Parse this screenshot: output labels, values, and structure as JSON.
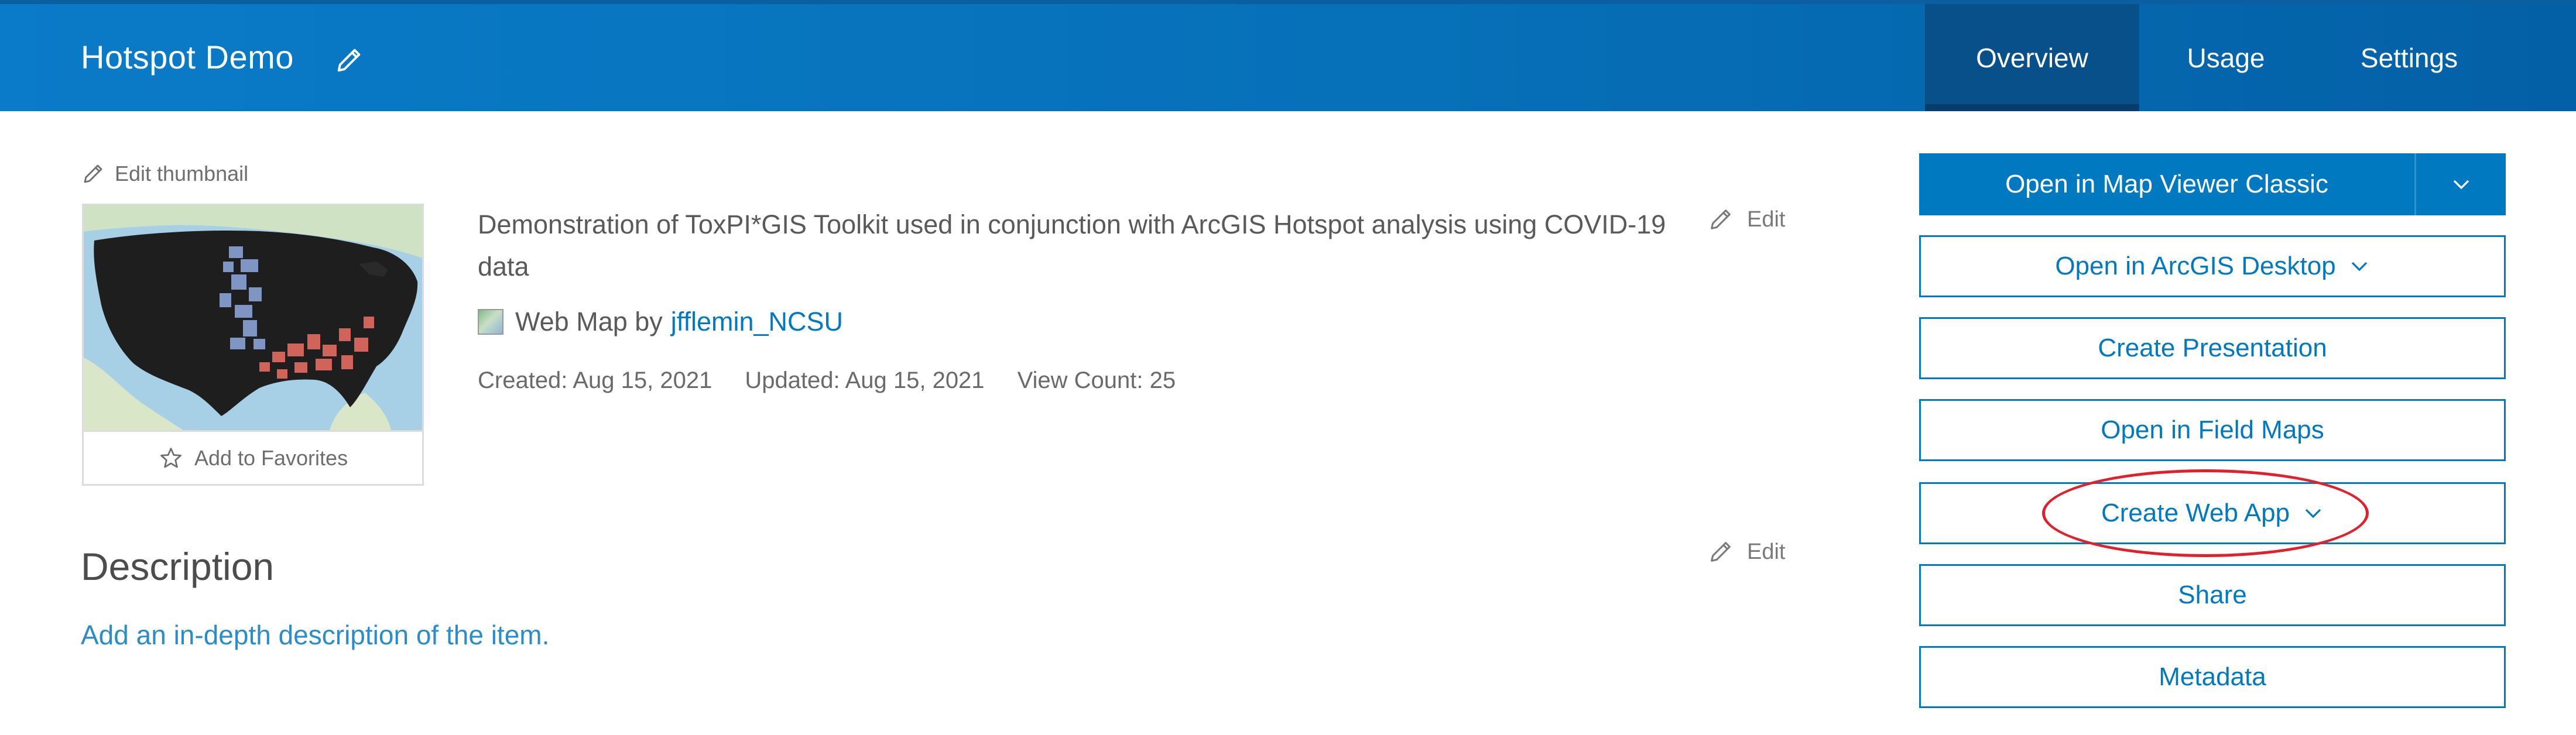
{
  "header": {
    "title": "Hotspot Demo",
    "tabs": [
      {
        "label": "Overview",
        "active": true
      },
      {
        "label": "Usage",
        "active": false
      },
      {
        "label": "Settings",
        "active": false
      }
    ],
    "accent_color": "#0079c1"
  },
  "thumbnail": {
    "edit_label": "Edit thumbnail",
    "favorites_label": "Add to Favorites"
  },
  "summary": {
    "text": "Demonstration of ToxPI*GIS Toolkit used in conjunction with ArcGIS Hotspot analysis using COVID-19 data",
    "edit_label": "Edit"
  },
  "item": {
    "type_label": "Web Map by",
    "owner": "jfflemin_NCSU",
    "created": "Created: Aug 15, 2021",
    "updated": "Updated: Aug 15, 2021",
    "view_count": "View Count: 25"
  },
  "description": {
    "title": "Description",
    "edit_label": "Edit",
    "placeholder_link": "Add an in-depth description of the item."
  },
  "actions": {
    "open_map_viewer": "Open in Map Viewer Classic",
    "open_desktop": "Open in ArcGIS Desktop",
    "create_presentation": "Create Presentation",
    "open_field_maps": "Open in Field Maps",
    "create_web_app": "Create Web App",
    "share": "Share",
    "metadata": "Metadata"
  },
  "icons": {
    "edit": "pencil-icon",
    "favorite": "star-icon",
    "dropdown": "chevron-down-icon",
    "item_type": "web-map-icon"
  },
  "annotation": {
    "highlight_color": "#e0202a"
  }
}
